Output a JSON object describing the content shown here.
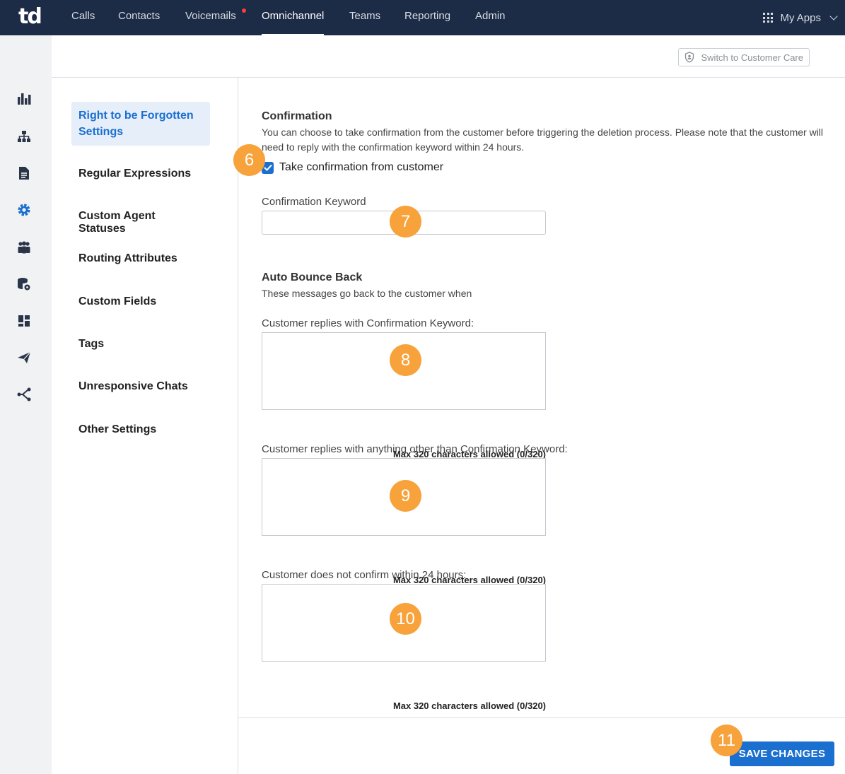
{
  "topnav": {
    "logo": "td",
    "items": [
      "Calls",
      "Contacts",
      "Voicemails",
      "Omnichannel",
      "Teams",
      "Reporting",
      "Admin"
    ],
    "active": "Omnichannel",
    "my_apps": "My Apps"
  },
  "header": {
    "switch_label": "Switch to Customer Care"
  },
  "sidebar": {
    "items": [
      "Right to be Forgotten Settings",
      "Regular Expressions",
      "Custom Agent Statuses",
      "Routing Attributes",
      "Custom Fields",
      "Tags",
      "Unresponsive Chats",
      "Other Settings"
    ]
  },
  "confirmation": {
    "title": "Confirmation",
    "description": "You can choose to take confirmation from the customer before triggering the deletion process. Please note that the customer will need to reply with the confirmation keyword within 24 hours.",
    "checkbox_label": "Take confirmation from customer",
    "checked": true,
    "keyword_label": "Confirmation Keyword",
    "keyword_value": ""
  },
  "bounce": {
    "title": "Auto Bounce Back",
    "description": "These messages go back to the customer when",
    "fields": [
      {
        "label": "Customer replies with Confirmation Keyword:",
        "counter": "Max 320 characters allowed (0/320)"
      },
      {
        "label": "Customer replies with anything other than Confirmation Keyword:",
        "counter": "Max 320 characters allowed (0/320)"
      },
      {
        "label": "Customer does not confirm within 24 hours:",
        "counter": "Max 320 characters allowed (0/320)"
      }
    ]
  },
  "save_label": "SAVE CHANGES",
  "markers": [
    "6",
    "7",
    "8",
    "9",
    "10",
    "11"
  ],
  "colors": {
    "nav_bg": "#1c2b46",
    "accent": "#1b6fcf",
    "marker": "#f7a23a"
  }
}
